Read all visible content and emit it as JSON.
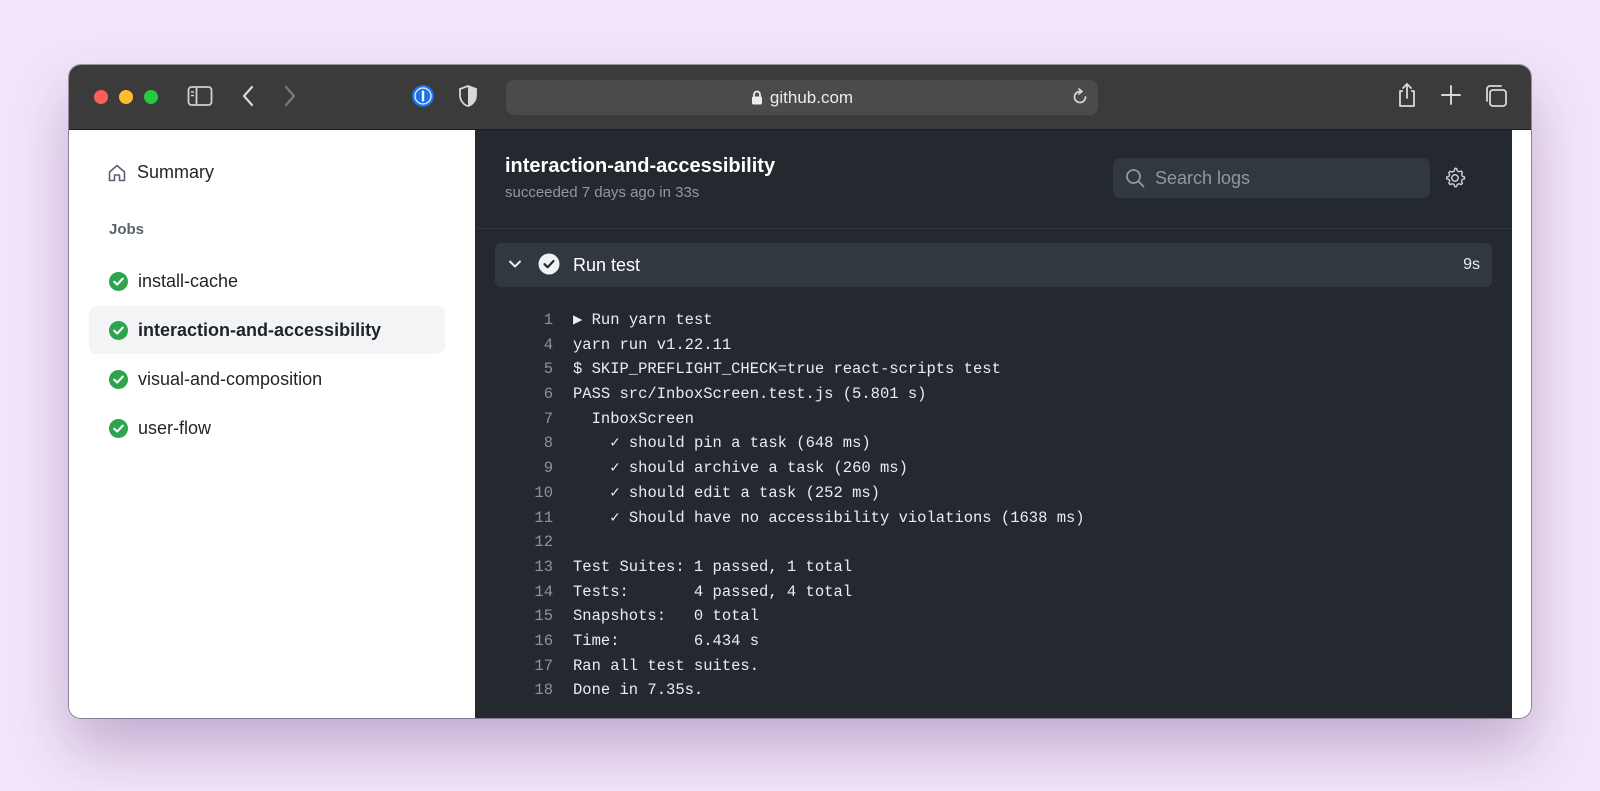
{
  "browser": {
    "url": "github.com"
  },
  "sidebar": {
    "summary_label": "Summary",
    "jobs_title": "Jobs",
    "jobs": [
      {
        "label": "install-cache",
        "active": false
      },
      {
        "label": "interaction-and-accessibility",
        "active": true
      },
      {
        "label": "visual-and-composition",
        "active": false
      },
      {
        "label": "user-flow",
        "active": false
      }
    ]
  },
  "main": {
    "job_title": "interaction-and-accessibility",
    "job_subtitle": "succeeded 7 days ago in 33s",
    "search_placeholder": "Search logs",
    "step": {
      "name": "Run test",
      "duration": "9s"
    },
    "log_lines": [
      {
        "num": "1",
        "text": "▶ Run yarn test"
      },
      {
        "num": "4",
        "text": "yarn run v1.22.11"
      },
      {
        "num": "5",
        "text": "$ SKIP_PREFLIGHT_CHECK=true react-scripts test"
      },
      {
        "num": "6",
        "text": "PASS src/InboxScreen.test.js (5.801 s)"
      },
      {
        "num": "7",
        "text": "  InboxScreen"
      },
      {
        "num": "8",
        "text": "    ✓ should pin a task (648 ms)"
      },
      {
        "num": "9",
        "text": "    ✓ should archive a task (260 ms)"
      },
      {
        "num": "10",
        "text": "    ✓ should edit a task (252 ms)"
      },
      {
        "num": "11",
        "text": "    ✓ Should have no accessibility violations (1638 ms)"
      },
      {
        "num": "12",
        "text": ""
      },
      {
        "num": "13",
        "text": "Test Suites: 1 passed, 1 total"
      },
      {
        "num": "14",
        "text": "Tests:       4 passed, 4 total"
      },
      {
        "num": "15",
        "text": "Snapshots:   0 total"
      },
      {
        "num": "16",
        "text": "Time:        6.434 s"
      },
      {
        "num": "17",
        "text": "Ran all test suites."
      },
      {
        "num": "18",
        "text": "Done in 7.35s."
      }
    ]
  },
  "colors": {
    "success": "#2da44e",
    "log_background": "#24292f",
    "toolbar": "#3b3b3c"
  }
}
